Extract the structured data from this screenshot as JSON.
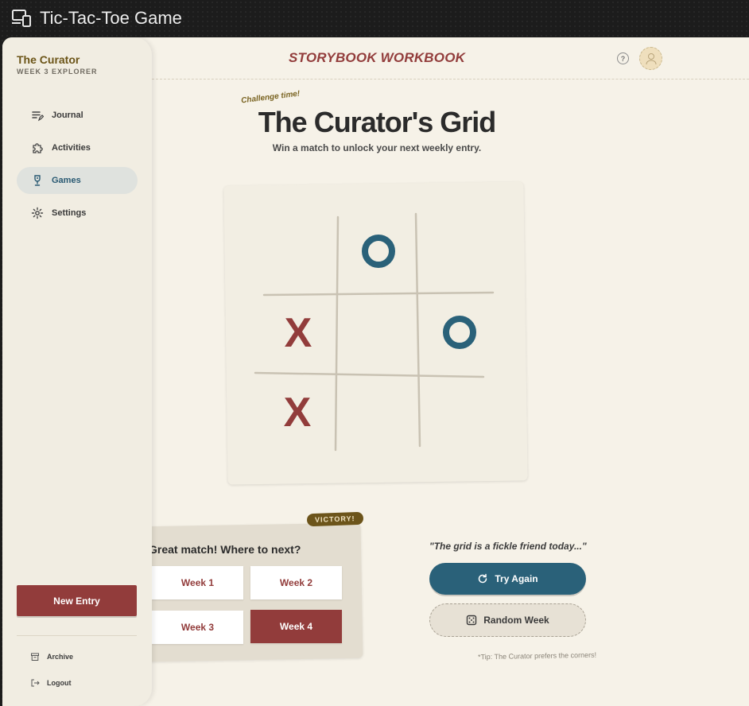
{
  "window": {
    "title": "Tic-Tac-Toe Game",
    "icon": "devices-icon"
  },
  "sidebar": {
    "brand_title": "The Curator",
    "brand_subtitle": "WEEK 3 EXPLORER",
    "items": [
      {
        "label": "Journal",
        "icon": "journal-icon",
        "active": false
      },
      {
        "label": "Activities",
        "icon": "puzzle-icon",
        "active": false
      },
      {
        "label": "Games",
        "icon": "trophy-icon",
        "active": true
      },
      {
        "label": "Settings",
        "icon": "gear-icon",
        "active": false
      }
    ],
    "new_entry_label": "New Entry",
    "archive_label": "Archive",
    "logout_label": "Logout"
  },
  "header": {
    "title": "STORYBOOK WORKBOOK",
    "help": "?"
  },
  "game": {
    "tag": "Challenge time!",
    "title": "The Curator's Grid",
    "subtitle": "Win a match to unlock your next weekly entry.",
    "board": [
      "",
      "O",
      "",
      "X",
      "",
      "O",
      "X",
      "",
      ""
    ]
  },
  "victory": {
    "badge": "VICTORY!",
    "question": "Great match! Where to next?",
    "weeks": [
      {
        "label": "Week 1",
        "active": false
      },
      {
        "label": "Week 2",
        "active": false
      },
      {
        "label": "Week 3",
        "active": false
      },
      {
        "label": "Week 4",
        "active": true
      }
    ]
  },
  "actions": {
    "quote": "\"The grid is a fickle friend today...\"",
    "try_again": "Try Again",
    "random_week": "Random Week",
    "tip": "*Tip: The Curator prefers the corners!"
  },
  "colors": {
    "x": "#923c3b",
    "o": "#2a6179",
    "accent": "#923c3b",
    "primary": "#2a6179",
    "brand": "#6b5417"
  }
}
